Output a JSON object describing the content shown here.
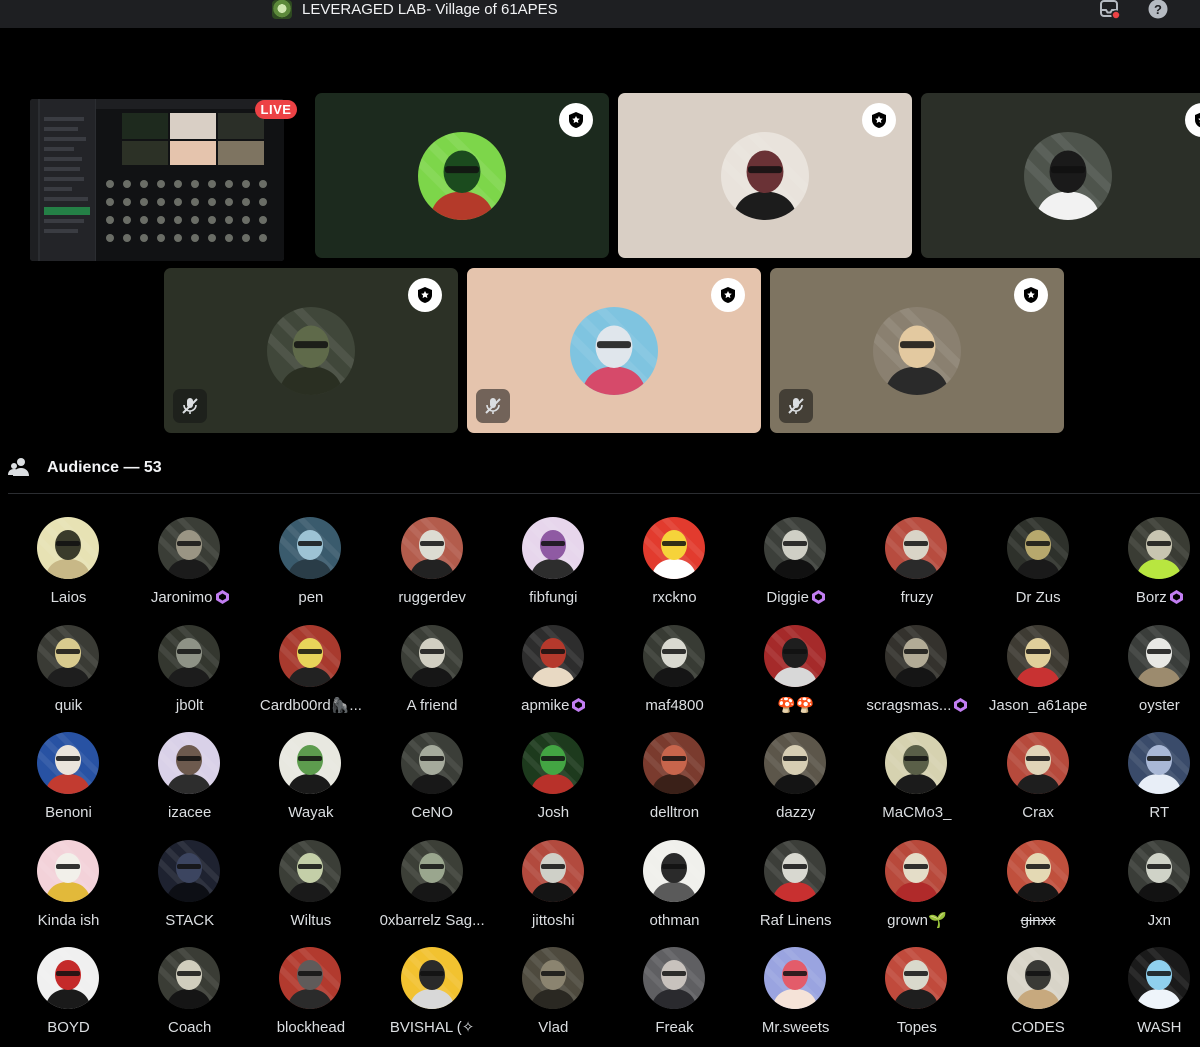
{
  "window": {
    "title": "LEVERAGED LAB- Village of 61APES"
  },
  "titlebar_icons": [
    "inbox-icon",
    "help-icon"
  ],
  "stage": {
    "live_label": "LIVE",
    "speakers": [
      {
        "bg": "#1c2a1e",
        "avatar": [
          "#7dd64a",
          "#1b4b1e",
          "#b43a2a"
        ],
        "moderator": true,
        "muted": false
      },
      {
        "bg": "#d9cfc5",
        "avatar": [
          "#e9e3dc",
          "#6a3236",
          "#1c1c1c"
        ],
        "moderator": true,
        "muted": false
      },
      {
        "bg": "#2b2f28",
        "avatar": [
          "#4e544c",
          "#1a1a1a",
          "#f2f2f2"
        ],
        "moderator": true,
        "muted": false
      },
      {
        "bg": "#2c3126",
        "avatar": [
          "#40473a",
          "#5f6a4a",
          "#2a2f22"
        ],
        "moderator": true,
        "muted": true
      },
      {
        "bg": "#e5c4ad",
        "avatar": [
          "#7fc4e0",
          "#e0e6ec",
          "#d64a6a"
        ],
        "moderator": true,
        "muted": true
      },
      {
        "bg": "#7e7461",
        "avatar": [
          "#8a8070",
          "#e3c9a0",
          "#2a2a2a"
        ],
        "moderator": true,
        "muted": true
      }
    ]
  },
  "audience": {
    "title": "Audience — 53",
    "members": [
      {
        "name": "Laios",
        "c": [
          "#e7e2b4",
          "#3a3b2b",
          "#c8b887"
        ],
        "nitro": false
      },
      {
        "name": "Jaronimo",
        "c": [
          "#3a3d36",
          "#9a9584",
          "#1b1b1b"
        ],
        "nitro": true
      },
      {
        "name": "pen",
        "c": [
          "#3a5b6d",
          "#9dc3d4",
          "#2a3d48"
        ],
        "nitro": false
      },
      {
        "name": "ruggerdev",
        "c": [
          "#b35c4c",
          "#dcdcd2",
          "#222"
        ],
        "nitro": false
      },
      {
        "name": "fibfungi",
        "c": [
          "#e7d6ec",
          "#8f5aa3",
          "#2d2d2d"
        ],
        "nitro": false
      },
      {
        "name": "rxckno",
        "c": [
          "#e23b2e",
          "#f6d33a",
          "#fff"
        ],
        "nitro": false
      },
      {
        "name": "Diggie",
        "c": [
          "#3c3f3a",
          "#cfcfc5",
          "#111"
        ],
        "nitro": true
      },
      {
        "name": "fruzy",
        "c": [
          "#b74c3f",
          "#d9d4c7",
          "#2a2a2a"
        ],
        "nitro": false
      },
      {
        "name": "Dr Zus",
        "c": [
          "#2e312b",
          "#b7a86d",
          "#1a1a1a"
        ],
        "nitro": false
      },
      {
        "name": "Borz",
        "c": [
          "#3a3c34",
          "#c8c5b1",
          "#b8e640"
        ],
        "nitro": true
      },
      {
        "name": "quik",
        "c": [
          "#3a3b35",
          "#d8ca8e",
          "#1e1e1e"
        ],
        "nitro": false
      },
      {
        "name": "jb0lt",
        "c": [
          "#34372f",
          "#8e9286",
          "#1c1c1c"
        ],
        "nitro": false
      },
      {
        "name": "Cardb00rd🦍...",
        "c": [
          "#a83a2e",
          "#e8d45a",
          "#222"
        ],
        "nitro": false
      },
      {
        "name": "A friend",
        "c": [
          "#3b3e37",
          "#d1cfc2",
          "#161616"
        ],
        "nitro": false
      },
      {
        "name": "apmike",
        "c": [
          "#2d2d2d",
          "#b5392c",
          "#e8d9c3"
        ],
        "nitro": true
      },
      {
        "name": "maf4800",
        "c": [
          "#383b34",
          "#d9d9d0",
          "#151515"
        ],
        "nitro": false
      },
      {
        "name": "🍄🍄",
        "c": [
          "#a52a2a",
          "#1e1e1e",
          "#d8d8d8"
        ],
        "nitro": false
      },
      {
        "name": "scragsmas...",
        "c": [
          "#34322d",
          "#b2ab96",
          "#151515"
        ],
        "nitro": true
      },
      {
        "name": "Jason_a61ape",
        "c": [
          "#3e3b33",
          "#e0cf9b",
          "#c83232"
        ],
        "nitro": false
      },
      {
        "name": "oyster",
        "c": [
          "#3a3d3a",
          "#e8e8e4",
          "#9c8b6e"
        ],
        "nitro": false
      },
      {
        "name": "Benoni",
        "c": [
          "#2852a3",
          "#eae4dc",
          "#c23b30"
        ],
        "nitro": false
      },
      {
        "name": "izacee",
        "c": [
          "#d9d1e8",
          "#6d5a4e",
          "#2d2d2d"
        ],
        "nitro": false
      },
      {
        "name": "Wayak",
        "c": [
          "#e8e8e0",
          "#5d9c4e",
          "#1a1a1a"
        ],
        "nitro": false
      },
      {
        "name": "CeNO",
        "c": [
          "#3b3e38",
          "#a5aa9c",
          "#181818"
        ],
        "nitro": false
      },
      {
        "name": "Josh",
        "c": [
          "#1d3a1d",
          "#43a543",
          "#b8312a"
        ],
        "nitro": false
      },
      {
        "name": "delltron",
        "c": [
          "#7a3b2e",
          "#c7654c",
          "#3a2018"
        ],
        "nitro": false
      },
      {
        "name": "dazzy",
        "c": [
          "#5c564a",
          "#d6cdb3",
          "#141414"
        ],
        "nitro": false
      },
      {
        "name": "MaCMo3_",
        "c": [
          "#d6d2b0",
          "#5a5f48",
          "#1b1b1b"
        ],
        "nitro": false
      },
      {
        "name": "Crax",
        "c": [
          "#b64a3c",
          "#e0d4b8",
          "#1e1e1e"
        ],
        "nitro": false
      },
      {
        "name": "RT",
        "c": [
          "#3a4b6a",
          "#a9b8d6",
          "#e8eef7"
        ],
        "nitro": false
      },
      {
        "name": "Kinda ish",
        "c": [
          "#f3d2d9",
          "#f2f0ea",
          "#e2b93a"
        ],
        "nitro": false
      },
      {
        "name": "STACK",
        "c": [
          "#1e2230",
          "#3c4560",
          "#0d0f15"
        ],
        "nitro": false
      },
      {
        "name": "Wiltus",
        "c": [
          "#3b3e37",
          "#c4cfa8",
          "#1a1a1a"
        ],
        "nitro": false
      },
      {
        "name": "0xbarrelz Sag...",
        "c": [
          "#3c3f37",
          "#9aa68e",
          "#161616"
        ],
        "nitro": false
      },
      {
        "name": "jittoshi",
        "c": [
          "#b24a3e",
          "#cfd0c8",
          "#141414"
        ],
        "nitro": false
      },
      {
        "name": "othman",
        "c": [
          "#f0f0ec",
          "#2a2a2a",
          "#5a5a5a"
        ],
        "nitro": false
      },
      {
        "name": "Raf Linens",
        "c": [
          "#3c3e39",
          "#d8d8d0",
          "#c83030"
        ],
        "nitro": false
      },
      {
        "name": "grown🌱",
        "c": [
          "#b8493b",
          "#e4ddc8",
          "#b02a2a"
        ],
        "nitro": false
      },
      {
        "name": "ginxx",
        "c": [
          "#c0503d",
          "#e4d9b4",
          "#161616"
        ],
        "nitro": false,
        "strike": true
      },
      {
        "name": "Jxn",
        "c": [
          "#3a3d38",
          "#d0d3c8",
          "#121212"
        ],
        "nitro": false
      },
      {
        "name": "BOYD",
        "c": [
          "#f0f0f0",
          "#c42a2a",
          "#1a1a1a"
        ],
        "nitro": false
      },
      {
        "name": "Coach",
        "c": [
          "#3a3c35",
          "#d0cdbd",
          "#151515"
        ],
        "nitro": false
      },
      {
        "name": "blockhead",
        "c": [
          "#b23a2e",
          "#5f5b5a",
          "#2b2b2b"
        ],
        "nitro": false
      },
      {
        "name": "BVISHAL (✧",
        "c": [
          "#f2c230",
          "#2a2a2a",
          "#d8d8d8"
        ],
        "nitro": false
      },
      {
        "name": "Vlad",
        "c": [
          "#4e4a3e",
          "#8b8470",
          "#2a2822"
        ],
        "nitro": false
      },
      {
        "name": "Freak",
        "c": [
          "#5f5f62",
          "#c8c2bd",
          "#2a2a2e"
        ],
        "nitro": false
      },
      {
        "name": "Mr.sweets",
        "c": [
          "#9aa4e0",
          "#e35c6a",
          "#f5e3d8"
        ],
        "nitro": false
      },
      {
        "name": "Topes",
        "c": [
          "#c04a3c",
          "#d9d9cc",
          "#1e1e1e"
        ],
        "nitro": false
      },
      {
        "name": "CODES",
        "c": [
          "#d8d4c8",
          "#3a3a36",
          "#c7a97e"
        ],
        "nitro": false
      },
      {
        "name": "WASH",
        "c": [
          "#1a1a1a",
          "#8fd0ee",
          "#eef4fa"
        ],
        "nitro": false
      }
    ]
  }
}
